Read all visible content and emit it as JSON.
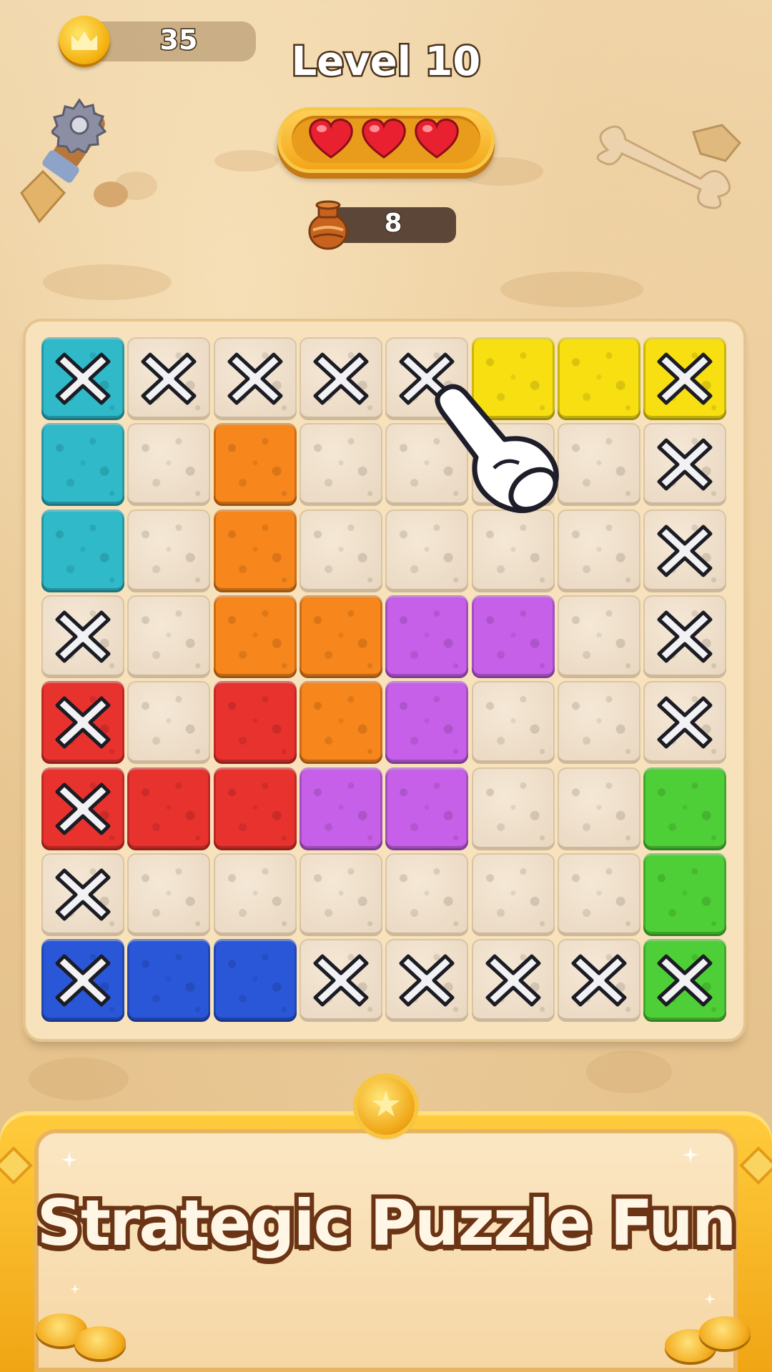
{
  "hud": {
    "coins": "35",
    "level_title": "Level 10",
    "hearts": 3,
    "pots": "8"
  },
  "icons": {
    "coin": "crown-coin-icon",
    "settings": "gear-icon",
    "pot": "clay-pot-icon",
    "heart": "heart-icon",
    "blocked": "x-mark-icon",
    "hand": "pointing-hand-icon"
  },
  "colors": {
    "teal": "#2fb9c9",
    "yellow": "#f7df12",
    "orange": "#f7861c",
    "purple": "#c760e8",
    "red": "#e8322e",
    "green": "#4fcf37",
    "blue": "#2a57d8",
    "empty": "#eadbc6"
  },
  "board": {
    "rows": 8,
    "cols": 8,
    "grid": [
      [
        "teal",
        "empty",
        "empty",
        "empty",
        "empty",
        "yellow",
        "yellow",
        "yellow"
      ],
      [
        "teal",
        "empty",
        "orange",
        "empty",
        "empty",
        "empty",
        "empty",
        "empty"
      ],
      [
        "teal",
        "empty",
        "orange",
        "empty",
        "empty",
        "empty",
        "empty",
        "empty"
      ],
      [
        "empty",
        "empty",
        "orange",
        "orange",
        "purple",
        "purple",
        "empty",
        "empty"
      ],
      [
        "red",
        "empty",
        "red",
        "orange",
        "purple",
        "empty",
        "empty",
        "empty"
      ],
      [
        "red",
        "red",
        "red",
        "purple",
        "purple",
        "empty",
        "empty",
        "green"
      ],
      [
        "empty",
        "empty",
        "empty",
        "empty",
        "empty",
        "empty",
        "empty",
        "green"
      ],
      [
        "blue",
        "blue",
        "blue",
        "empty",
        "empty",
        "empty",
        "empty",
        "green"
      ]
    ],
    "marks": [
      [
        1,
        1,
        1,
        1,
        1,
        0,
        0,
        1
      ],
      [
        0,
        0,
        0,
        0,
        0,
        0,
        0,
        1
      ],
      [
        0,
        0,
        0,
        0,
        0,
        0,
        0,
        1
      ],
      [
        1,
        0,
        0,
        0,
        0,
        0,
        0,
        1
      ],
      [
        1,
        0,
        0,
        0,
        0,
        0,
        0,
        1
      ],
      [
        1,
        0,
        0,
        0,
        0,
        0,
        0,
        0
      ],
      [
        1,
        0,
        0,
        0,
        0,
        0,
        0,
        0
      ],
      [
        1,
        0,
        0,
        1,
        1,
        1,
        1,
        1
      ]
    ]
  },
  "banner": {
    "text": "Strategic Puzzle Fun"
  }
}
